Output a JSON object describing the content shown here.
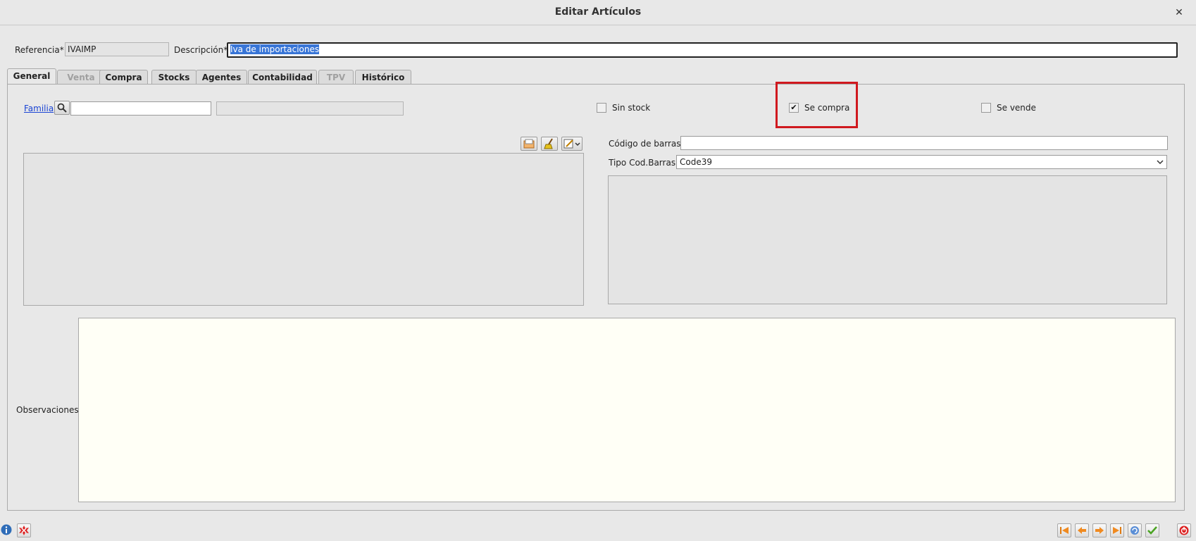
{
  "window": {
    "title": "Editar Artículos",
    "close_glyph": "✕"
  },
  "header": {
    "referencia_label": "Referencia*",
    "referencia_value": "IVAIMP",
    "descripcion_label": "Descripción*",
    "descripcion_value": "Iva de importaciones"
  },
  "tabs": [
    {
      "label": "General",
      "state": "active"
    },
    {
      "label": "Venta",
      "state": "disabled"
    },
    {
      "label": "Compra",
      "state": "enabled"
    },
    {
      "label": "Stocks",
      "state": "enabled"
    },
    {
      "label": "Agentes",
      "state": "enabled"
    },
    {
      "label": "Contabilidad",
      "state": "enabled"
    },
    {
      "label": "TPV",
      "state": "disabled"
    },
    {
      "label": "Histórico",
      "state": "enabled"
    }
  ],
  "general": {
    "familia_label": "Familia",
    "familia_code": "",
    "familia_desc": "",
    "sin_stock_label": "Sin stock",
    "sin_stock_checked": false,
    "se_compra_label": "Se compra",
    "se_compra_checked": true,
    "se_vende_label": "Se vende",
    "se_vende_checked": false,
    "codigo_barras_label": "Código de barras",
    "codigo_barras_value": "",
    "tipo_cod_barras_label": "Tipo Cod.Barras",
    "tipo_cod_barras_value": "Code39",
    "observaciones_label": "Observaciones",
    "observaciones_value": ""
  },
  "icons": {
    "search": "search-icon",
    "open_image": "folder-icon",
    "clear_image": "broom-icon",
    "edit_image": "edit-icon",
    "info": "info-icon",
    "delete": "delete-icon",
    "first": "first-record-icon",
    "prev": "previous-record-icon",
    "next": "next-record-icon",
    "last": "last-record-icon",
    "refresh": "refresh-icon",
    "accept": "accept-icon",
    "exit": "exit-icon"
  },
  "colors": {
    "highlight": "#d0191f",
    "link": "#1a44d4",
    "selection": "#3875d7",
    "observaciones_bg": "#fffff6"
  }
}
